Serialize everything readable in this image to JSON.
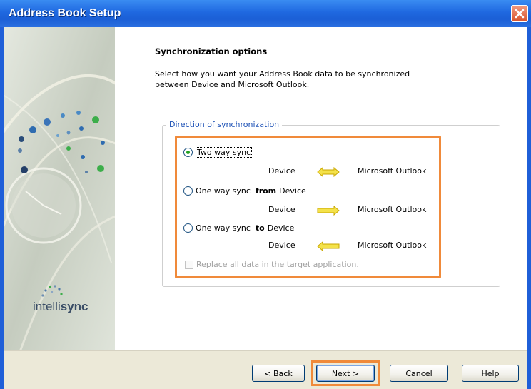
{
  "window": {
    "title": "Address Book Setup",
    "close_icon": "close-icon",
    "accent_color": "#1f68e0"
  },
  "branding": {
    "logo_text_light": "intelli",
    "logo_text_bold": "sync",
    "logo_icon": "intellisync-dots-logo"
  },
  "page": {
    "heading": "Synchronization options",
    "description": "Select how you want your Address Book data to be synchronized between Device and Microsoft Outlook."
  },
  "direction_group": {
    "legend": "Direction of synchronization",
    "options": [
      {
        "label": "Two way sync",
        "label_suffix": "",
        "label_tail": "",
        "selected": true,
        "device": "Device",
        "arrow_icon": "bidirectional-arrow-icon",
        "target": "Microsoft Outlook"
      },
      {
        "label": "One way sync",
        "label_suffix": "from",
        "label_tail": "Device",
        "selected": false,
        "device": "Device",
        "arrow_icon": "right-arrow-icon",
        "target": "Microsoft Outlook"
      },
      {
        "label": "One way sync",
        "label_suffix": "to",
        "label_tail": "Device",
        "selected": false,
        "device": "Device",
        "arrow_icon": "left-arrow-icon",
        "target": "Microsoft Outlook"
      }
    ],
    "replace_checkbox": {
      "label": "Replace all data in the target application.",
      "checked": false,
      "enabled": false
    },
    "highlight_color": "#f08a3a"
  },
  "buttons": {
    "back": "< Back",
    "next": "Next >",
    "cancel": "Cancel",
    "help": "Help"
  }
}
